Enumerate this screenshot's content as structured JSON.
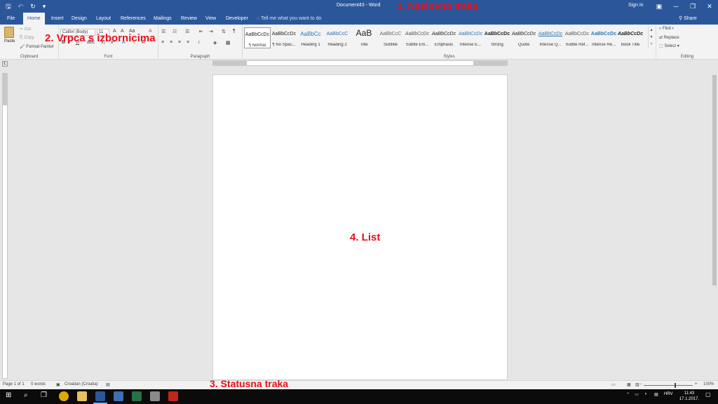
{
  "titlebar": {
    "qat_save": "🖫",
    "qat_undo": "↶",
    "qat_redo": "↻",
    "qat_customize": "▾",
    "title": "Document43 - Word",
    "sign_in": "Sign in",
    "ribbon_options": "▣",
    "minimize": "─",
    "restore": "❐",
    "close": "✕"
  },
  "tabs": {
    "items": [
      "File",
      "Home",
      "Insert",
      "Design",
      "Layout",
      "References",
      "Mailings",
      "Review",
      "View",
      "Developer"
    ],
    "active": "Home",
    "tell_me": "Tell me what you want to do",
    "share": "Share"
  },
  "clipboard": {
    "paste": "Paste",
    "cut": "Cut",
    "copy": "Copy",
    "format_painter": "Format Painter",
    "label": "Clipboard"
  },
  "font": {
    "name": "Calibri (Body)",
    "size": "11",
    "label": "Font"
  },
  "paragraph": {
    "label": "Paragraph"
  },
  "styles": {
    "label": "Styles",
    "items": [
      {
        "preview": "AaBbCcDc",
        "name": "¶ Normal"
      },
      {
        "preview": "AaBbCcDc",
        "name": "¶ No Spac..."
      },
      {
        "preview": "AaBbCc",
        "name": "Heading 1"
      },
      {
        "preview": "AaBbCcC",
        "name": "Heading 2"
      },
      {
        "preview": "AaB",
        "name": "Title"
      },
      {
        "preview": "AaBbCcC",
        "name": "Subtitle"
      },
      {
        "preview": "AaBbCcDc",
        "name": "Subtle Em..."
      },
      {
        "preview": "AaBbCcDc",
        "name": "Emphasis"
      },
      {
        "preview": "AaBbCcDc",
        "name": "Intense E..."
      },
      {
        "preview": "AaBbCcDc",
        "name": "Strong"
      },
      {
        "preview": "AaBbCcDc",
        "name": "Quote"
      },
      {
        "preview": "AaBbCcDc",
        "name": "Intense Q..."
      },
      {
        "preview": "AaBbCcDc",
        "name": "Subtle Ref..."
      },
      {
        "preview": "AaBbCcDc",
        "name": "Intense Re..."
      },
      {
        "preview": "AaBbCcDc",
        "name": "Book Title"
      }
    ]
  },
  "editing": {
    "find": "Find",
    "replace": "Replace",
    "select": "Select",
    "label": "Editing"
  },
  "status": {
    "page": "Page 1 of 1",
    "words": "0 words",
    "language": "Croatian (Croatia)",
    "zoom": "100%"
  },
  "taskbar": {
    "language": "HRV",
    "time": "11:43",
    "date": "17.1.2017."
  },
  "annotations": {
    "title_bar": "1. Naslovna traka",
    "ribbon": "2. Vrpca s izbornicima",
    "status_bar": "3. Statusna traka",
    "sheet": "4. List"
  },
  "colors": {
    "word_blue": "#2b579a",
    "annotation_red": "#e8101c"
  }
}
